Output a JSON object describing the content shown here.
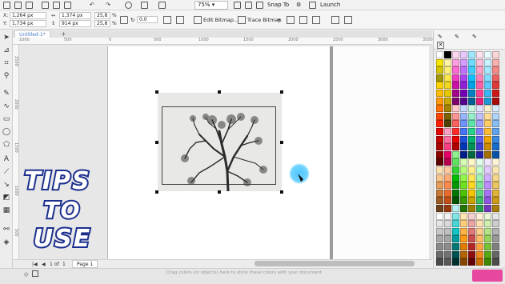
{
  "toolbar": {
    "zoom_value": "75%",
    "snap_label": "Snap To",
    "launch_label": "Launch"
  },
  "propbar": {
    "x_label": "X:",
    "x_value": "1,264 px",
    "y_label": "Y:",
    "y_value": "1,734 px",
    "w_value": "1,374 px",
    "h_value": "914 px",
    "scale_x": "25,8",
    "scale_y": "25,8",
    "pct": "%",
    "angle_value": "0,0",
    "edit_bitmap_label": "Edit Bitmap...",
    "trace_bitmap_label": "Trace Bitmap"
  },
  "doc_tab": {
    "title": "Untitled-1*",
    "add_symbol": "+"
  },
  "rulers": {
    "h_numbers": [
      "1000",
      "500",
      "0",
      "500",
      "1000",
      "1500",
      "2000",
      "2500",
      "3000",
      "3500"
    ],
    "v_numbers": [
      "2500",
      "2000",
      "1500",
      "1000",
      "500"
    ]
  },
  "overlay": {
    "line1": "TIPS",
    "line2": "TO",
    "line3": "USE"
  },
  "page_nav": {
    "current": "1",
    "of_label": "of",
    "total": "1",
    "page_tab": "Page 1"
  },
  "status": {
    "hint": "Drag colors (or objects) here to store these colors with your document"
  },
  "colors": {
    "accent": "#4a78c2",
    "cursor_highlight": "#4fc7ff"
  },
  "palette_columns": [
    [
      "#ffffff",
      "#f7e600",
      "#d5c600",
      "#a39800",
      "#ffd200",
      "#ffbb00",
      "#ff9a00",
      "#ff7100",
      "#ff4600",
      "#ff1e00",
      "#e20000",
      "#c40000",
      "#a80000",
      "#8a0000",
      "#5d0000",
      "#fde1b0",
      "#f7c58b",
      "#e49d5a",
      "#c87837",
      "#9e5a25",
      "#70401a",
      "#ffffff",
      "#e6e6e6",
      "#c8c8c8",
      "#a9a9a9",
      "#8a8a8a",
      "#6a6a6a",
      "#4a4a4a"
    ],
    [
      "#000000",
      "#fff3a6",
      "#fff07a",
      "#fbe84b",
      "#f0d823",
      "#e4c800",
      "#caa800",
      "#a48400",
      "#7a6200",
      "#4f3f00",
      "#ff9fc2",
      "#ff6fa2",
      "#ff3d84",
      "#e50066",
      "#b8004f",
      "#ffc8a1",
      "#ffab78",
      "#ff8a4e",
      "#e86b2d",
      "#c45018",
      "#95390e",
      "#f2f2f2",
      "#d9d9d9",
      "#bfbfbf",
      "#a6a6a6",
      "#8c8c8c",
      "#737373",
      "#595959"
    ],
    [
      "#ffd7f1",
      "#ff9fe0",
      "#ff6bd2",
      "#f03cc2",
      "#cc11a6",
      "#a3008a",
      "#7c006b",
      "#ffc9c9",
      "#ff9595",
      "#ff6060",
      "#ff2c2c",
      "#e60000",
      "#ad0000",
      "#8ef28e",
      "#5fe35f",
      "#2fd12f",
      "#00bd00",
      "#009a00",
      "#007600",
      "#005400",
      "#b4f0f0",
      "#7fe5e5",
      "#48d6d6",
      "#13c4c4",
      "#009e9e",
      "#007777",
      "#005252",
      "#002f2f"
    ],
    [
      "#e7c9ff",
      "#d49dff",
      "#c070ff",
      "#a944f2",
      "#8f1fd9",
      "#7200b5",
      "#55008a",
      "#c5d6ff",
      "#9ab6ff",
      "#6e95ff",
      "#4473f5",
      "#1c52dc",
      "#0037b5",
      "#001e87",
      "#d7ffb4",
      "#b6ff7a",
      "#94f54a",
      "#6ee21c",
      "#4fc300",
      "#389c00",
      "#247300",
      "#ffe5b4",
      "#ffce7a",
      "#ffb446",
      "#ff9a15",
      "#e07d00",
      "#b56200",
      "#874700"
    ],
    [
      "#9ee7ff",
      "#6fdcff",
      "#3fcfff",
      "#0ebfff",
      "#00a2e8",
      "#0080c0",
      "#005f93",
      "#c9f7e4",
      "#95efca",
      "#5fe3ad",
      "#28d28d",
      "#00b56f",
      "#008f56",
      "#00693e",
      "#fff8c6",
      "#fff08e",
      "#ffe656",
      "#ffd91f",
      "#f2c500",
      "#caa300",
      "#9d7f00",
      "#f5d0d0",
      "#eaa4a4",
      "#dc7878",
      "#cb4c4c",
      "#b52424",
      "#8f0f0f",
      "#640303"
    ],
    [
      "#ffe0ee",
      "#ffc0dc",
      "#ff9fca",
      "#ff7fb8",
      "#ff5fa6",
      "#ff3f94",
      "#e61f7a",
      "#e0e0ff",
      "#c0c0ff",
      "#a0a0ff",
      "#8080ff",
      "#6060f0",
      "#4040d0",
      "#2020a8",
      "#e0ffe6",
      "#c0ffcc",
      "#a0f5b3",
      "#7fe699",
      "#5fd480",
      "#3fbd66",
      "#219e4c",
      "#fff0d9",
      "#ffe0b3",
      "#ffce8c",
      "#ffba66",
      "#ffa33f",
      "#f08a1f",
      "#cf6e00"
    ],
    [
      "#e8fbff",
      "#c9f3ff",
      "#a6e9ff",
      "#84dcff",
      "#5fcbff",
      "#3ab6f5",
      "#1a9ad9",
      "#ffeecc",
      "#ffdd99",
      "#ffcc66",
      "#ffbb33",
      "#f2a600",
      "#cc8b00",
      "#a36f00",
      "#f2e6ff",
      "#e2caff",
      "#cfadff",
      "#bb8fff",
      "#a672f5",
      "#8e55e0",
      "#7238c0",
      "#e8f7d8",
      "#d0efb0",
      "#b5e387",
      "#97d45d",
      "#77c236",
      "#58a815",
      "#3f8700"
    ],
    [
      "#fdd7d7",
      "#f9b0b0",
      "#f38888",
      "#eb6161",
      "#df3a3a",
      "#cc1818",
      "#a80a0a",
      "#d7eafd",
      "#b0d4f9",
      "#88bcf3",
      "#61a3eb",
      "#3a88df",
      "#186ccc",
      "#0a52a8",
      "#fdf3d7",
      "#f9e6b0",
      "#f3d688",
      "#ebc561",
      "#dfb23a",
      "#cc9c18",
      "#a87d0a",
      "#e6e6e6",
      "#cccccc",
      "#b3b3b3",
      "#999999",
      "#808080",
      "#666666",
      "#4d4d4d"
    ]
  ]
}
